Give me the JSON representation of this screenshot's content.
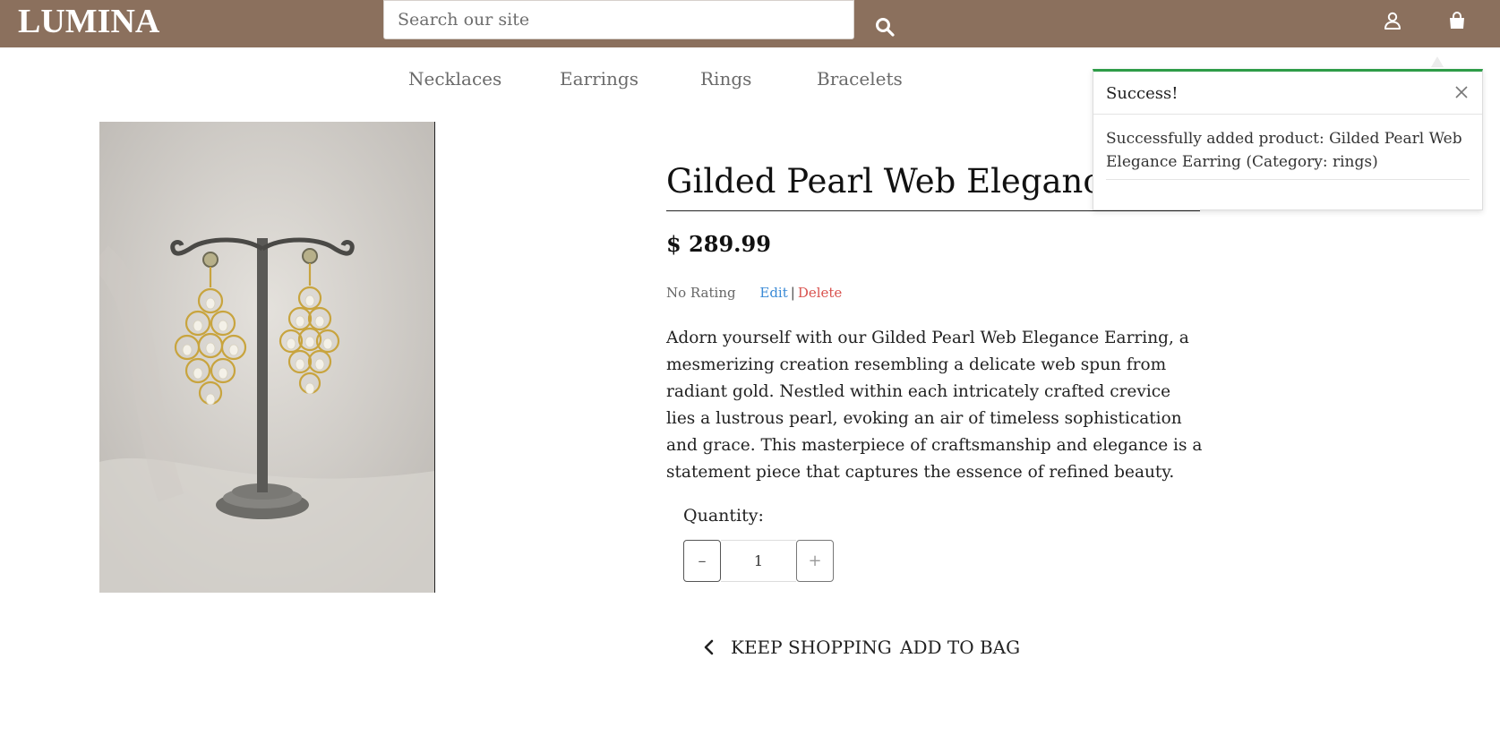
{
  "header": {
    "logo": "LUMINA",
    "search_placeholder": "Search our site",
    "background_color": "#8b705d"
  },
  "nav": {
    "items": [
      "Necklaces",
      "Earrings",
      "Rings",
      "Bracelets"
    ]
  },
  "product": {
    "title": "Gilded Pearl Web Elegance Earring",
    "price": "$ 289.99",
    "rating": "No Rating",
    "edit_label": "Edit",
    "separator": "|",
    "delete_label": "Delete",
    "description": "Adorn yourself with our Gilded Pearl Web Elegance Earring, a mesmerizing creation resembling a delicate web spun from radiant gold. Nestled within each intricately crafted crevice lies a lustrous pearl, evoking an air of timeless sophistication and grace. This masterpiece of craftsmanship and elegance is a statement piece that captures the essence of refined beauty.",
    "quantity_label": "Quantity:",
    "quantity_value": "1",
    "minus_label": "–",
    "plus_label": "+",
    "keep_shopping_label": "KEEP SHOPPING",
    "add_to_bag_label": "ADD TO BAG"
  },
  "toast": {
    "title": "Success!",
    "message": "Successfully added product: Gilded Pearl Web Elegance Earring (Category: rings)",
    "accent_color": "#2e9c48"
  },
  "colors": {
    "edit_link": "#3a8ad6",
    "delete_link": "#d9534f"
  }
}
